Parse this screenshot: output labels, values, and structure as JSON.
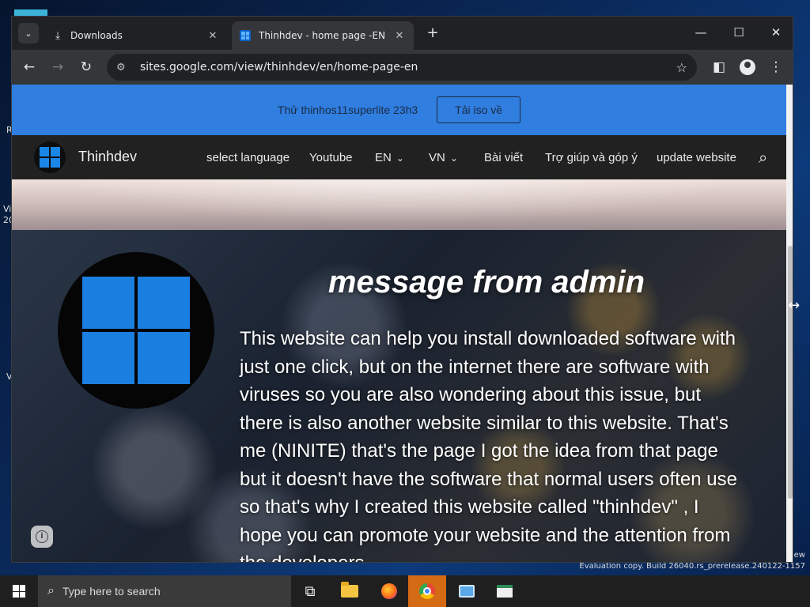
{
  "browser": {
    "tabs": [
      {
        "label": "Downloads",
        "icon": "download-icon"
      },
      {
        "label": "Thinhdev - home page -EN",
        "icon": "windows-favicon-icon"
      }
    ],
    "url": "sites.google.com/view/thinhdev/en/home-page-en"
  },
  "announcement": {
    "text": "Thử thinhos11superlite 23h3",
    "button_label": "Tải iso về",
    "background_color": "#2f7ee0"
  },
  "navbar": {
    "site_name": "Thinhdev",
    "items": [
      {
        "label": "select language"
      },
      {
        "label": "Youtube"
      },
      {
        "label": "EN"
      },
      {
        "label": "VN"
      },
      {
        "label": "Bài viết"
      },
      {
        "label": "Trợ giúp và góp ý"
      },
      {
        "label": "update website"
      }
    ]
  },
  "content": {
    "title": "message from admin",
    "body": "This website can help you install downloaded software with just one click, but on the internet there are software with viruses so you are also wondering about this issue, but there is also another website similar to this website. That's me (NINITE) that's the page I got the idea from that page but it doesn't have the software that normal users often use so that's why I created this website called \"thinhdev\" , I hope you can promote your website and the attention from the developers"
  },
  "desktop": {
    "fragments": [
      "R",
      "Vi",
      "20",
      "V"
    ],
    "watermark_new": "ew",
    "watermark": "Evaluation copy. Build 26040.rs_prerelease.240122-1157"
  },
  "taskbar": {
    "search_placeholder": "Type here to search",
    "apps": [
      "task-view-icon",
      "file-explorer-icon",
      "firefox-icon",
      "chrome-icon",
      "remote-desktop-icon",
      "app-icon"
    ]
  }
}
